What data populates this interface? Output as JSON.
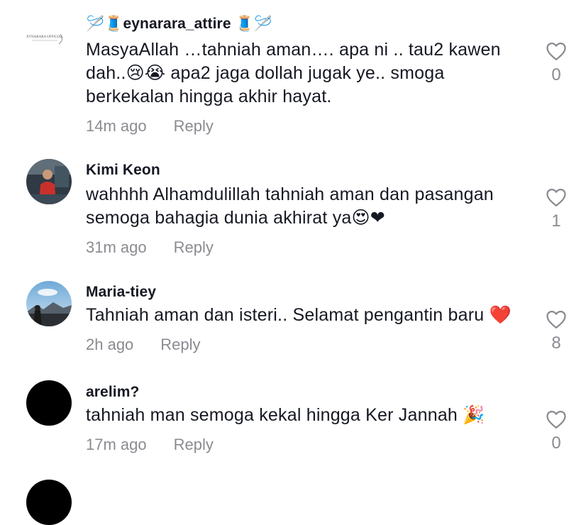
{
  "comments": [
    {
      "username": "eynarara_attire",
      "username_prefix": "🪡🧵",
      "username_suffix": "🧵🪡",
      "avatar_text": "EYNARARA OFFICIAL",
      "lines": [
        "MasyaAllah …tahniah aman…. apa ni .. tau2 kawen",
        "dah..😢😭 apa2 jaga dollah jugak ye.. smoga",
        "berkekalan hingga akhir hayat."
      ],
      "time": "14m ago",
      "reply": "Reply",
      "likes": "0"
    },
    {
      "username": "Kimi Keon",
      "lines": [
        "wahhhh Alhamdulillah tahniah aman dan pasangan",
        "semoga bahagia dunia akhirat ya😍❤"
      ],
      "time": "31m ago",
      "reply": "Reply",
      "likes": "1"
    },
    {
      "username": "Maria-tiey",
      "lines": [
        "Tahniah aman dan isteri.. Selamat pengantin baru ❤️"
      ],
      "time": "2h ago",
      "reply": "Reply",
      "likes": "8"
    },
    {
      "username": "arelim?",
      "lines": [
        "tahniah man semoga kekal hingga Ker Jannah 🎉"
      ],
      "time": "17m ago",
      "reply": "Reply",
      "likes": "0"
    }
  ],
  "colors": {
    "text": "#161823",
    "secondary": "#8a8b91",
    "heart_outline": "#8a8b91"
  }
}
